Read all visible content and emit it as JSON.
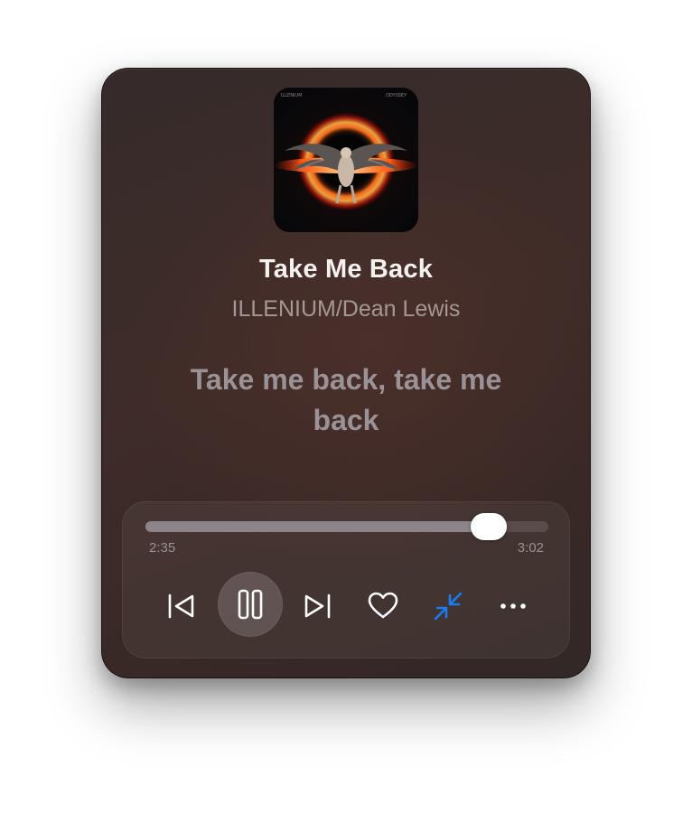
{
  "track": {
    "title": "Take Me Back",
    "artist": "ILLENIUM/Dean Lewis",
    "artwork": {
      "label_left": "ILLENIUM",
      "label_right": "ODYSSEY",
      "colors": [
        "#0c0b0c",
        "#ff5a12",
        "#ffb347",
        "#c91a0a"
      ]
    }
  },
  "lyrics": {
    "current_line": "Take me back, take me back"
  },
  "playback": {
    "elapsed": "2:35",
    "total": "3:02",
    "progress": 0.8516,
    "is_playing": true
  },
  "controls": [
    {
      "id": "previous",
      "icon": "previous-track-icon",
      "active": false
    },
    {
      "id": "play-pause",
      "icon": "pause-icon",
      "active": false
    },
    {
      "id": "next",
      "icon": "next-track-icon",
      "active": false
    },
    {
      "id": "like",
      "icon": "heart-outline-icon",
      "active": false
    },
    {
      "id": "mini-player",
      "icon": "collapse-arrows-icon",
      "active": true
    },
    {
      "id": "more",
      "icon": "ellipsis-icon",
      "active": false
    }
  ],
  "colors": {
    "accent": "#1a7cf0",
    "text_primary": "#f4f1f0",
    "text_secondary": "#a39896",
    "lyric": "#9a9296",
    "progress_fill": "#8b8488",
    "thumb": "#ffffff"
  }
}
